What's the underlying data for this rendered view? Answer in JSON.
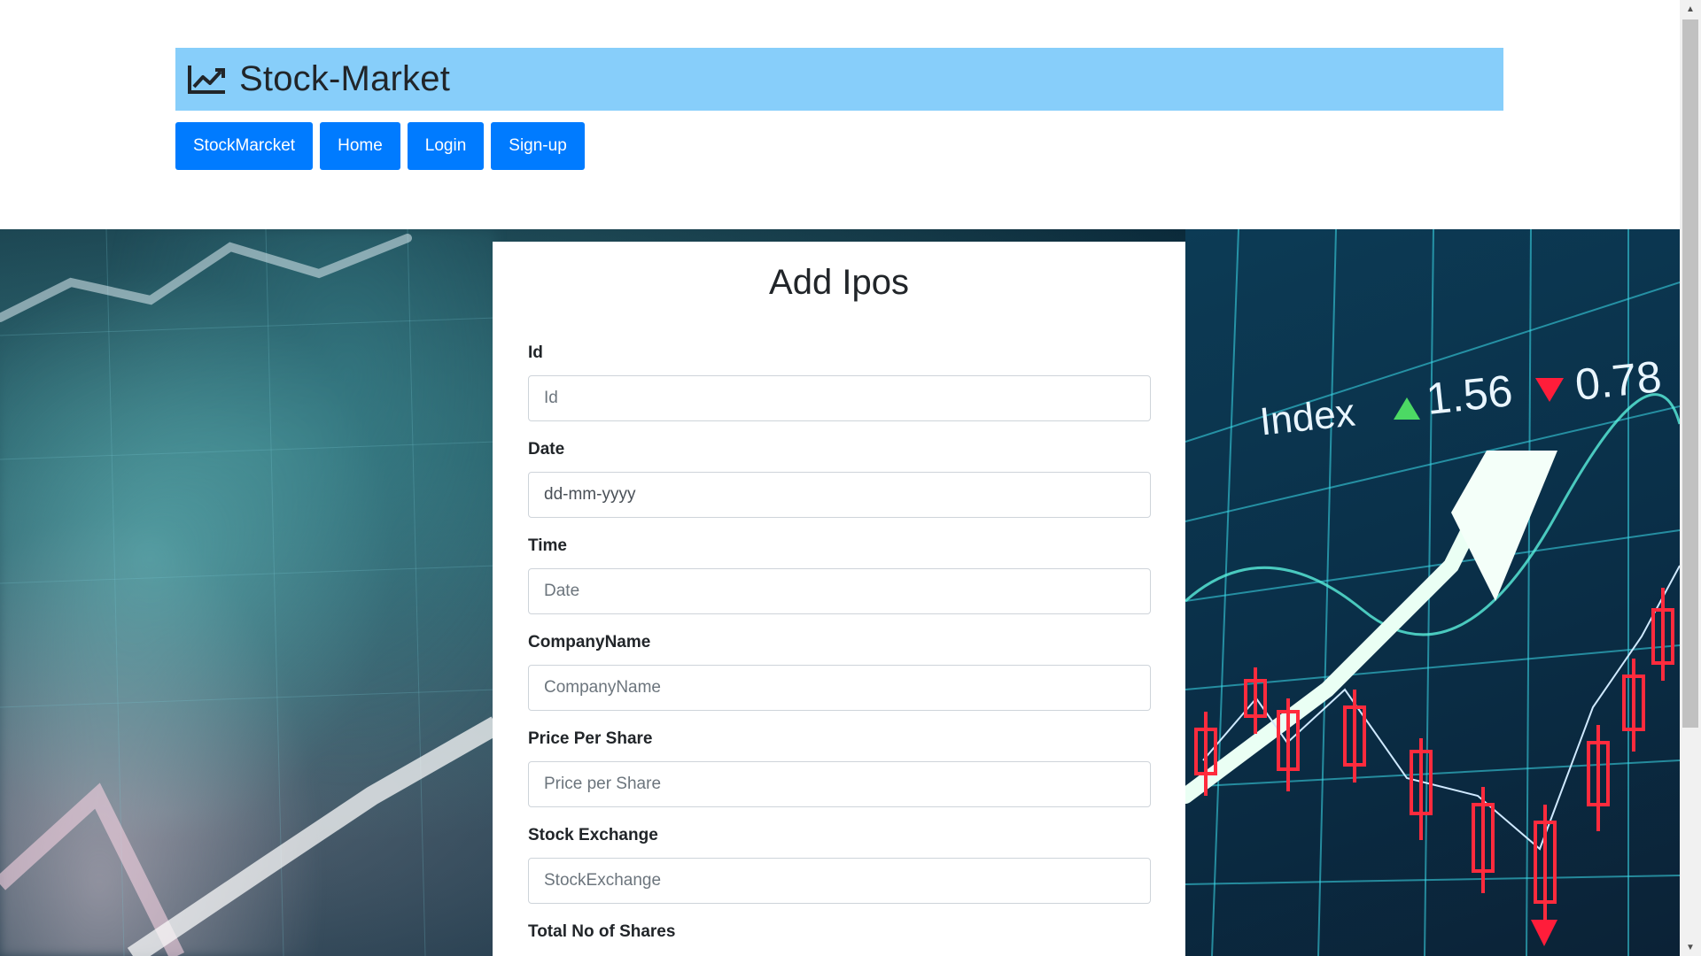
{
  "header": {
    "title": "Stock-Market",
    "icon": "chart-line-icon"
  },
  "nav": {
    "items": [
      {
        "label": "StockMarcket"
      },
      {
        "label": "Home"
      },
      {
        "label": "Login"
      },
      {
        "label": "Sign-up"
      }
    ]
  },
  "hero": {
    "index_label": "Index",
    "up_value": "1.56",
    "down_value": "0.78"
  },
  "form": {
    "title": "Add Ipos",
    "fields": [
      {
        "label": "Id",
        "placeholder": "Id",
        "value": ""
      },
      {
        "label": "Date",
        "placeholder": "dd-mm-yyyy",
        "value": ""
      },
      {
        "label": "Time",
        "placeholder": "Date",
        "value": ""
      },
      {
        "label": "CompanyName",
        "placeholder": "CompanyName",
        "value": ""
      },
      {
        "label": "Price Per Share",
        "placeholder": "Price per Share",
        "value": ""
      },
      {
        "label": "Stock Exchange",
        "placeholder": "StockExchange",
        "value": ""
      },
      {
        "label": "Total No of Shares",
        "placeholder": "",
        "value": ""
      }
    ]
  },
  "colors": {
    "brand_bar": "#87cefa",
    "button": "#007bff"
  }
}
